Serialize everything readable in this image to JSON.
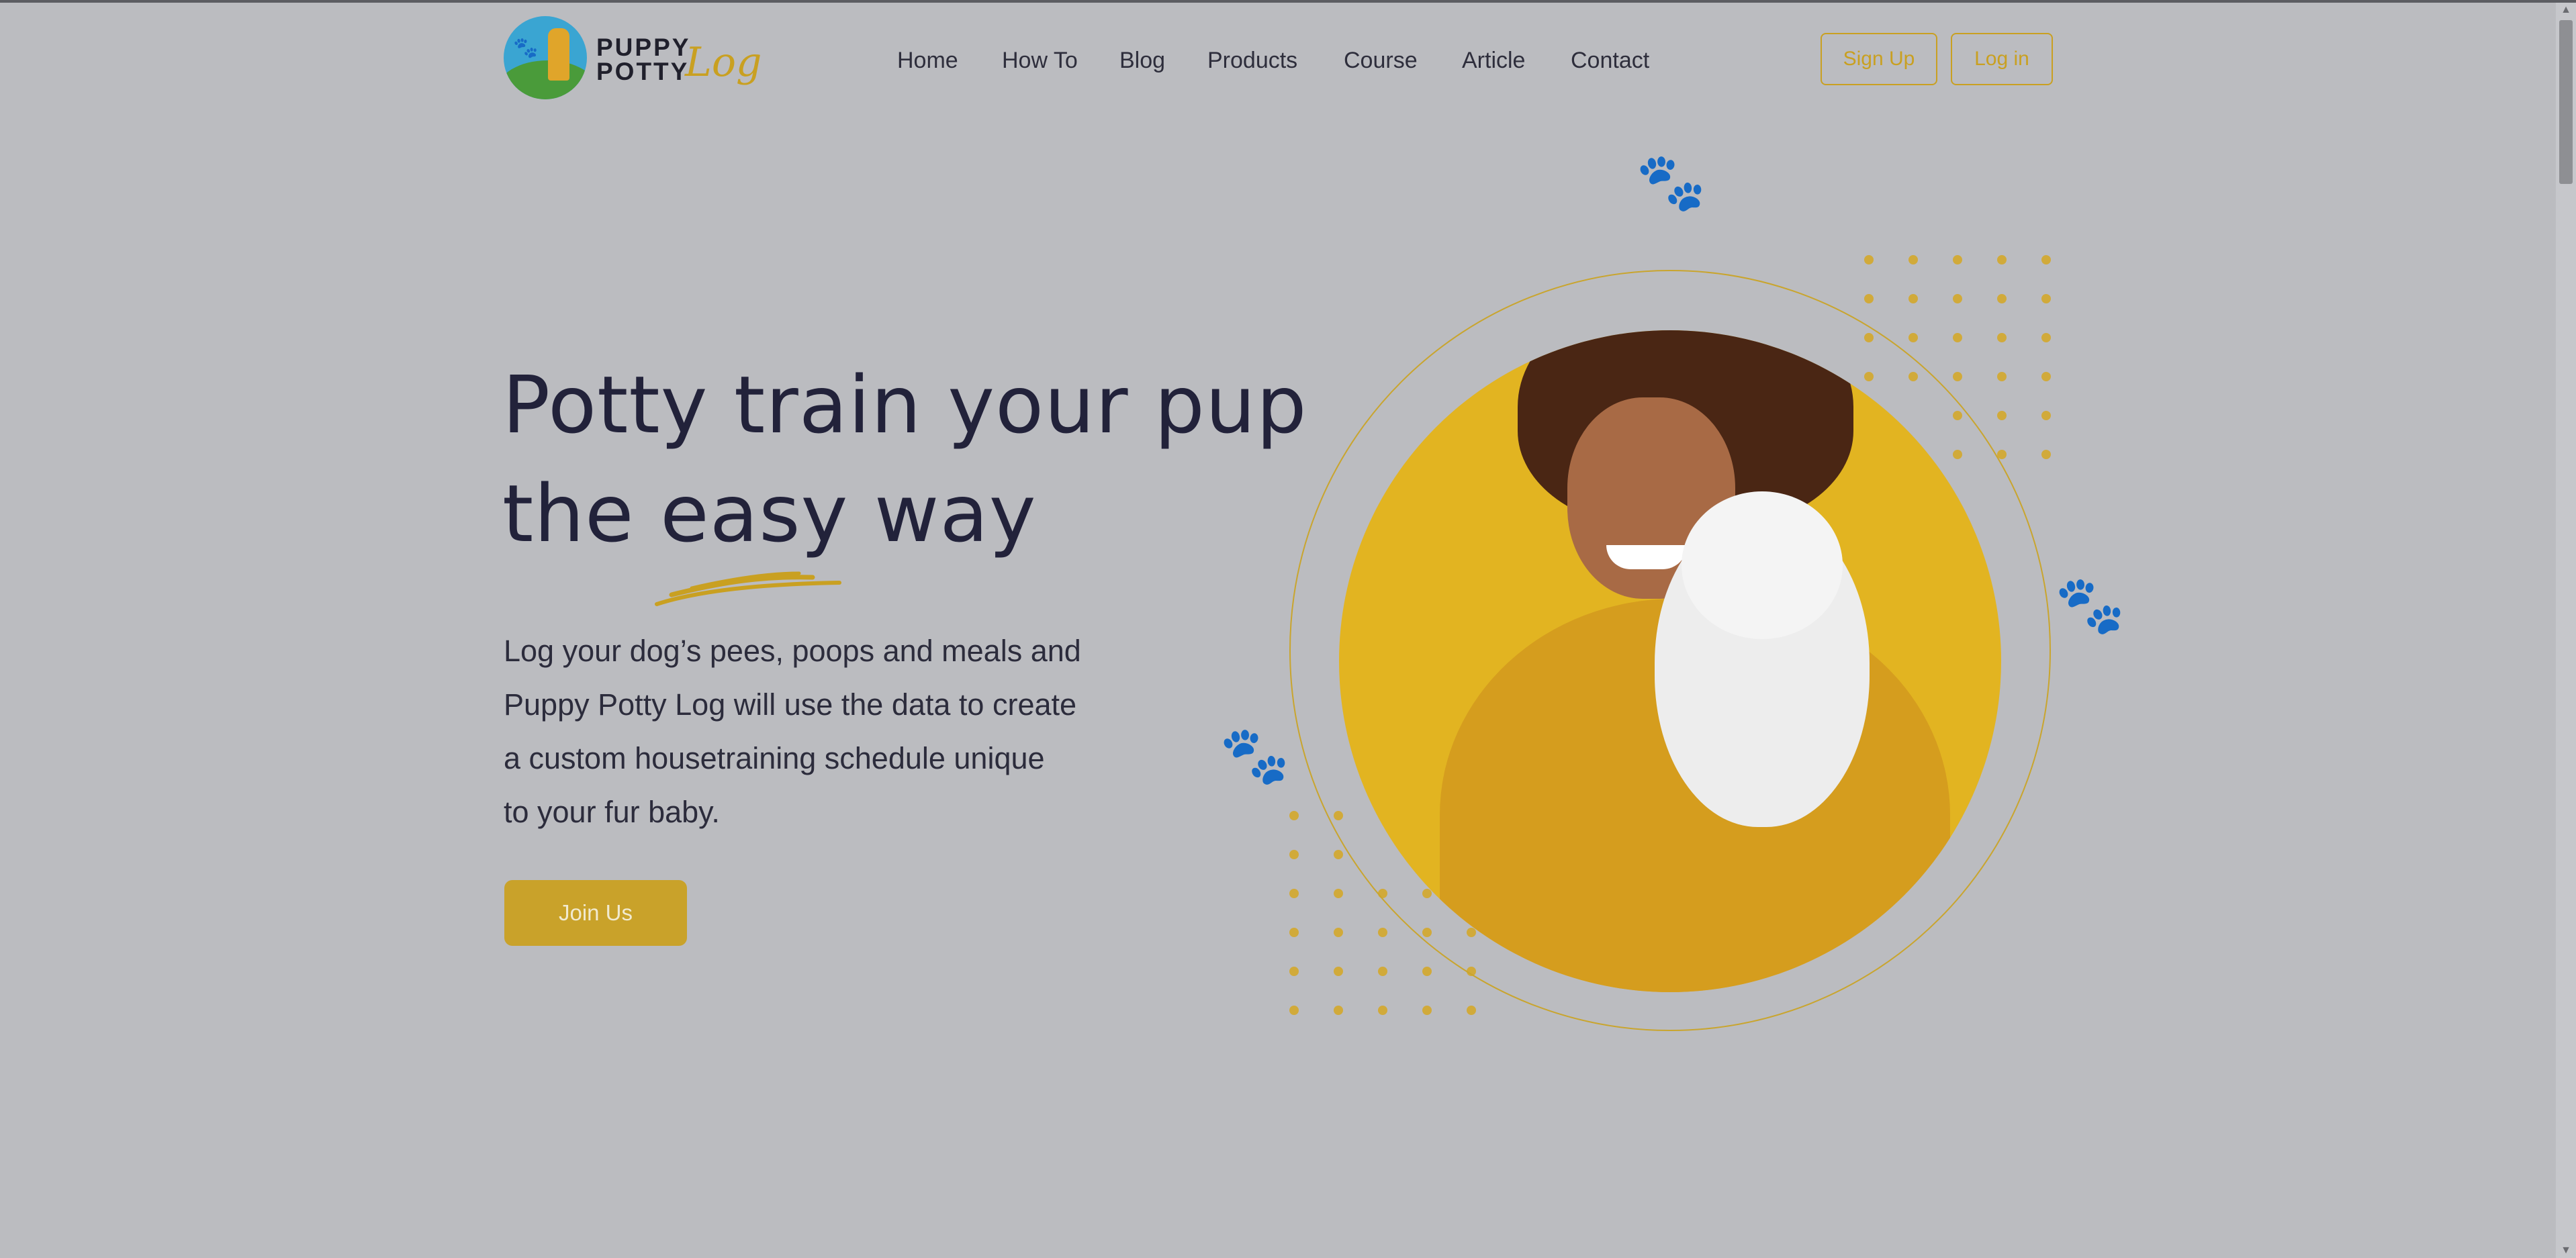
{
  "logo": {
    "word1": "PUPPY",
    "word2": "POTTY",
    "script": "Log"
  },
  "nav": {
    "items": [
      "Home",
      "How To",
      "Blog",
      "Products",
      "Course",
      "Article",
      "Contact"
    ]
  },
  "auth": {
    "signup_label": "Sign Up",
    "login_label": "Log in"
  },
  "hero": {
    "title_line1": "Potty train your pup",
    "title_line2": "the easy way",
    "description_lines": [
      "Log your dog’s pees, poops and meals and",
      "Puppy Potty Log will use the data to create",
      "a custom housetraining schedule unique",
      "to your fur baby."
    ],
    "cta_label": "Join Us"
  },
  "colors": {
    "accent": "#c9a021",
    "background": "#bbbcc0",
    "text": "#22223a"
  },
  "icons": {
    "paw": "paw-icon",
    "scroll_up": "chevron-up-icon",
    "scroll_down": "chevron-down-icon"
  }
}
